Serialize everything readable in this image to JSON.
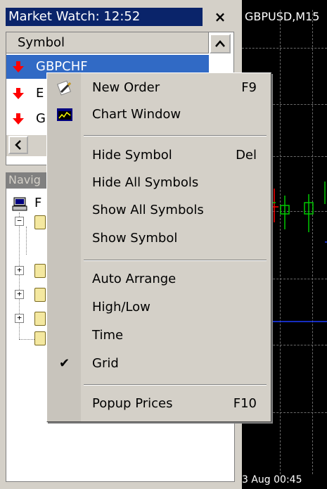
{
  "market_watch": {
    "title": "Market Watch: 12:52",
    "close_glyph": "×",
    "column_header": "Symbol",
    "rows": [
      {
        "symbol": "GBPCHF",
        "selected": true,
        "arrow_icon": "arrow-down-red"
      },
      {
        "symbol": "E",
        "selected": false,
        "arrow_icon": "arrow-down-red"
      },
      {
        "symbol": "G",
        "selected": false,
        "arrow_icon": "arrow-down-red"
      }
    ]
  },
  "navigator": {
    "title": "Navig",
    "root_label": "F"
  },
  "chart": {
    "title": "GBPUSD,M15",
    "date_label": "3 Aug 00:45",
    "colors": {
      "bull": "#00c800",
      "bear": "#ff0000",
      "hline": "#1e3cff"
    }
  },
  "context_menu": {
    "items": [
      {
        "label": "New Order",
        "shortcut": "F9",
        "icon": "new-order-icon"
      },
      {
        "label": "Chart Window",
        "shortcut": "",
        "icon": "chart-window-icon"
      },
      {
        "label": "Hide Symbol",
        "shortcut": "Del"
      },
      {
        "label": "Hide All Symbols",
        "shortcut": ""
      },
      {
        "label": "Show All Symbols",
        "shortcut": ""
      },
      {
        "label": "Show Symbol",
        "shortcut": ""
      },
      {
        "label": "Auto Arrange",
        "shortcut": ""
      },
      {
        "label": "High/Low",
        "shortcut": ""
      },
      {
        "label": "Time",
        "shortcut": ""
      },
      {
        "label": "Grid",
        "shortcut": "",
        "checked": true
      },
      {
        "label": "Popup Prices",
        "shortcut": "F10"
      }
    ],
    "check_glyph": "✔"
  }
}
